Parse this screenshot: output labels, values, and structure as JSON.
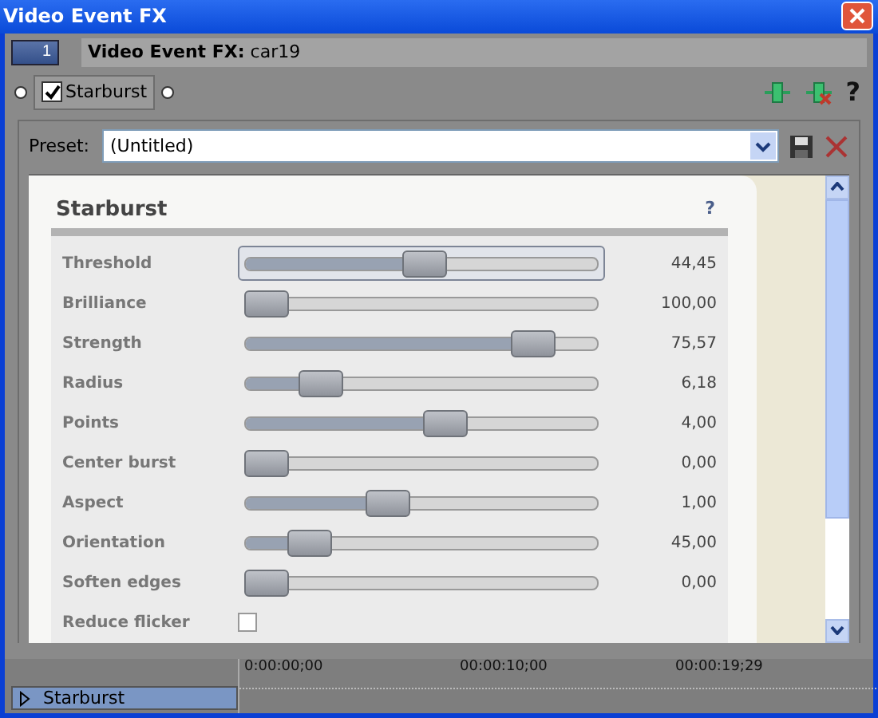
{
  "window": {
    "title": "Video Event FX"
  },
  "track_tab": {
    "label": "1"
  },
  "header": {
    "text": "**Video Event FX:** car19"
  },
  "chain": {
    "label": "Starburst",
    "checked": true
  },
  "toolbar": {
    "help": "?"
  },
  "preset": {
    "label": "Preset:",
    "value": "(Untitled)"
  },
  "card": {
    "title": "Starburst",
    "help": "?"
  },
  "sliders": [
    {
      "label": "Threshold",
      "level": 0.47,
      "reading": "44,45",
      "selected": true
    },
    {
      "label": "Brilliance",
      "level": 0,
      "reading": "100,00",
      "selected": false
    },
    {
      "label": "Strength",
      "level": 0.79,
      "reading": "75,57",
      "selected": false
    },
    {
      "label": "Radius",
      "level": 0.16,
      "reading": "6,18",
      "selected": false
    },
    {
      "label": "Points",
      "level": 0.53,
      "reading": "4,00",
      "selected": false
    },
    {
      "label": "Center burst",
      "level": 0,
      "reading": "0,00",
      "selected": false
    },
    {
      "label": "Aspect",
      "level": 0.36,
      "reading": "1,00",
      "selected": false
    },
    {
      "label": "Orientation",
      "level": 0.13,
      "reading": "45,00",
      "selected": false
    },
    {
      "label": "Soften edges",
      "level": 0,
      "reading": "0,00",
      "selected": false
    }
  ],
  "option": {
    "label": "Reduce flicker",
    "checked": false
  },
  "timeline": {
    "ticks": [
      "0:00:00;00",
      "00:00:10;00",
      "00:00:19;29"
    ],
    "track": "Starburst"
  }
}
